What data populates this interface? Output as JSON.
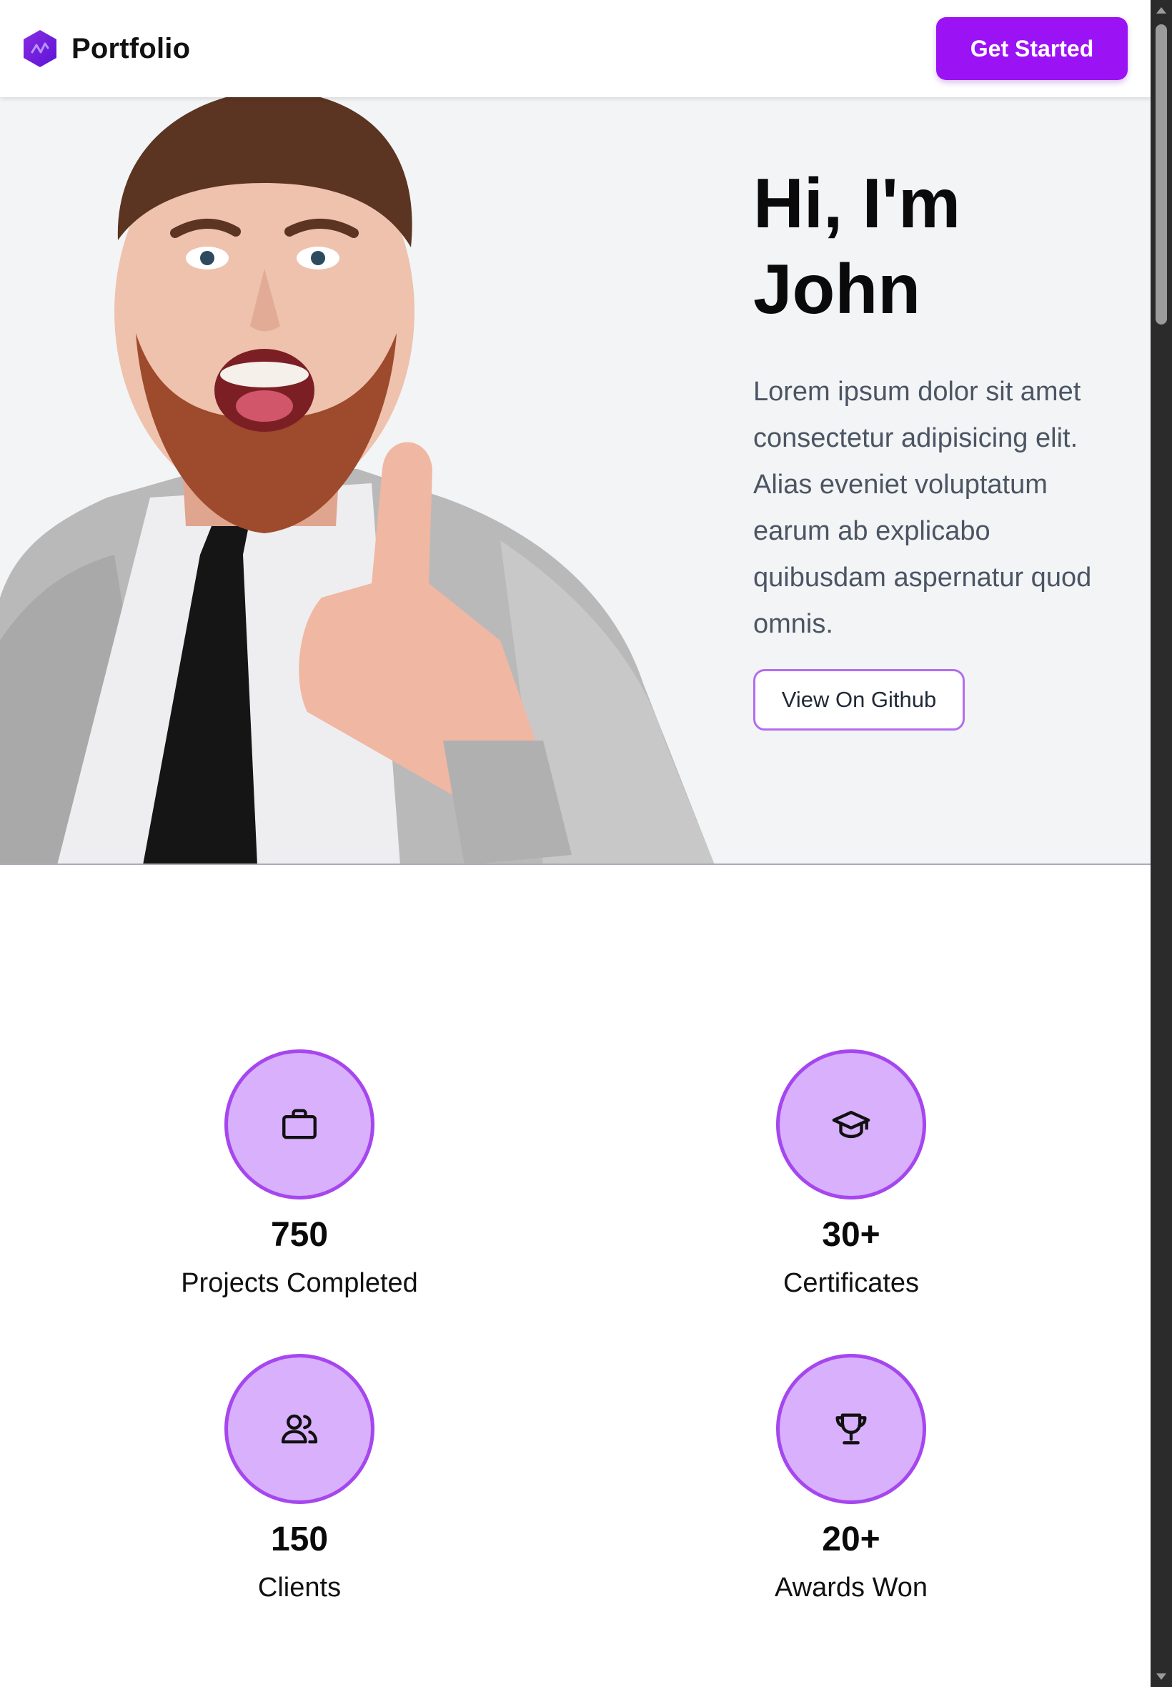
{
  "navbar": {
    "brand_name": "Portfolio",
    "cta_label": "Get Started"
  },
  "hero": {
    "title": "Hi, I'm John",
    "description": "Lorem ipsum dolor sit amet consectetur adipisicing elit. Alias eveniet voluptatum earum ab explicabo quibusdam aspernatur quod omnis.",
    "github_button": "View On Github"
  },
  "stats": [
    {
      "value": "750",
      "label": "Projects Completed",
      "icon": "briefcase-icon"
    },
    {
      "value": "30+",
      "label": "Certificates",
      "icon": "graduation-cap-icon"
    },
    {
      "value": "150",
      "label": "Clients",
      "icon": "users-icon"
    },
    {
      "value": "20+",
      "label": "Awards Won",
      "icon": "trophy-icon"
    }
  ],
  "colors": {
    "accent": "#9b12f5",
    "circle_fill": "#d8b0fb",
    "circle_border": "#a646ef",
    "hero_bg": "#f3f4f6"
  }
}
